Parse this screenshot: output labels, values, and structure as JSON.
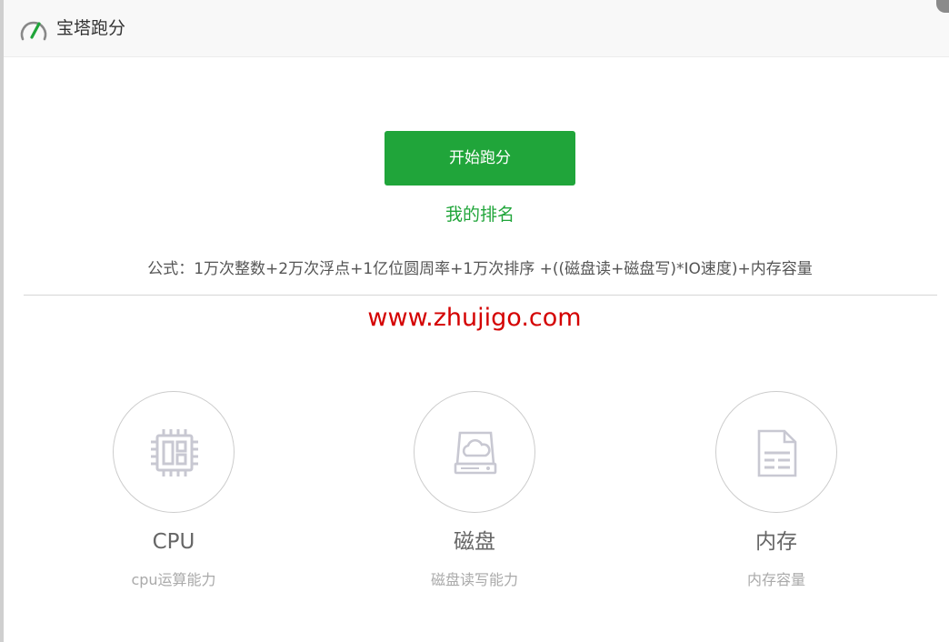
{
  "window": {
    "title": "宝塔跑分",
    "icon": "speedometer-icon"
  },
  "main": {
    "start_button": "开始跑分",
    "rank_link": "我的排名",
    "formula": "公式：1万次整数+2万次浮点+1亿位圆周率+1万次排序 +((磁盘读+磁盘写)*IO速度)+内存容量",
    "watermark": "www.zhujigo.com"
  },
  "items": [
    {
      "title": "CPU",
      "subtitle": "cpu运算能力",
      "icon": "cpu-chip-icon"
    },
    {
      "title": "磁盘",
      "subtitle": "磁盘读写能力",
      "icon": "cloud-disk-icon"
    },
    {
      "title": "内存",
      "subtitle": "内存容量",
      "icon": "memory-document-icon"
    }
  ],
  "colors": {
    "brand_green": "#20a53a",
    "watermark_red": "#d40000",
    "icon_gray": "#c8c8d2"
  }
}
